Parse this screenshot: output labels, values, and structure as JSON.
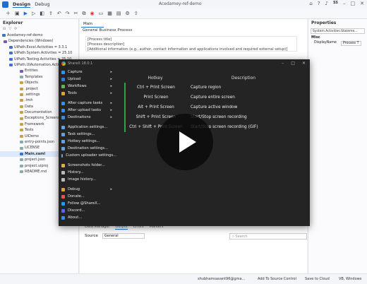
{
  "titlebar": {
    "tabs": [
      "Design",
      "Debug"
    ],
    "title": "Acedamey-ref-demo",
    "avatar_initials": "SS",
    "icons": [
      "home-icon",
      "question-icon",
      "bell-icon",
      "minimize-icon",
      "maximize-icon",
      "close-icon"
    ]
  },
  "explorer": {
    "title": "Explorer",
    "items": [
      "Acedamey-ref-demo",
      "Dependencies (Windows)",
      "UiPath.Excel.Activities = 3.3.1",
      "UiPath.System.Activities = 25.10",
      "UiPath.Testing.Activities = 25.10",
      "UiPath.UIAutomation.Activities",
      "Entities",
      "Templates",
      "Objects",
      ".project",
      ".settings",
      ".tmh",
      "Data",
      "Documentation",
      "Exceptions_Screenshots",
      "Framework",
      "Tests",
      "UiDemo",
      "entry-points.json",
      "LICENSE",
      "Main.xaml",
      "project.json",
      "project.uiproj",
      "README.md"
    ]
  },
  "editor": {
    "tab": "Main",
    "breadcrumb": "General Business Process",
    "comment_lines": [
      "[Process title]",
      "[Process description]",
      "[Additional information (e.g., author, contact information and applications involved and required external setup)]"
    ]
  },
  "output": {
    "tabs": [
      "Data Manager",
      "Output",
      "Errors",
      "Markers"
    ],
    "source_label": "Source",
    "source_value": "General",
    "search_placeholder": "Search"
  },
  "properties": {
    "title": "Properties",
    "search": "System.Activities.Stateme...",
    "group": "Misc",
    "row_label": "DisplayName",
    "row_value": "Process T"
  },
  "statusbar": {
    "user": "shubhamsavant96@gma...",
    "source_control": "Add To Source Control",
    "cloud": "Save to Cloud",
    "language": "VB, Windows"
  },
  "sharex": {
    "title": "ShareX 18.0.1",
    "menu": [
      {
        "label": "Capture",
        "submenu": true,
        "icon": "#3a8ee6"
      },
      {
        "label": "Upload",
        "submenu": true,
        "icon": "#2d7dd2"
      },
      {
        "label": "Workflows",
        "submenu": true,
        "icon": "#6ab04c"
      },
      {
        "label": "Tools",
        "submenu": true,
        "icon": "#e1a140"
      },
      {
        "sep": true
      },
      {
        "label": "After capture tasks",
        "submenu": true,
        "icon": "#3a8ee6"
      },
      {
        "label": "After upload tasks",
        "submenu": true,
        "icon": "#3a8ee6"
      },
      {
        "label": "Destinations",
        "submenu": true,
        "icon": "#3a8ee6"
      },
      {
        "sep": true
      },
      {
        "label": "Application settings...",
        "submenu": false,
        "icon": "#6aa0d8"
      },
      {
        "label": "Task settings...",
        "submenu": false,
        "icon": "#6aa0d8"
      },
      {
        "label": "Hotkey settings...",
        "submenu": false,
        "icon": "#6aa0d8"
      },
      {
        "label": "Destination settings...",
        "submenu": false,
        "icon": "#6aa0d8"
      },
      {
        "label": "Custom uploader settings...",
        "submenu": false,
        "icon": "#6aa0d8"
      },
      {
        "sep": true
      },
      {
        "label": "Screenshots folder...",
        "submenu": false,
        "icon": "#d9b24a"
      },
      {
        "label": "History...",
        "submenu": false,
        "icon": "#bbbbbb"
      },
      {
        "label": "Image history...",
        "submenu": false,
        "icon": "#bbbbbb"
      },
      {
        "sep": true
      },
      {
        "label": "Debug",
        "submenu": true,
        "icon": "#e0a03c"
      },
      {
        "label": "Donate...",
        "submenu": false,
        "icon": "#e05555"
      },
      {
        "label": "Follow @ShareX...",
        "submenu": false,
        "icon": "#1d9bf0"
      },
      {
        "label": "Discord...",
        "submenu": false,
        "icon": "#5865f2"
      },
      {
        "label": "About...",
        "submenu": false,
        "icon": "#3a8ee6"
      }
    ],
    "hotkeys": {
      "headers": [
        "Hotkey",
        "Description"
      ],
      "rows": [
        {
          "hotkey": "Ctrl + Print Screen",
          "description": "Capture region"
        },
        {
          "hotkey": "Print Screen",
          "description": "Capture entire screen"
        },
        {
          "hotkey": "Alt + Print Screen",
          "description": "Capture active window"
        },
        {
          "hotkey": "Shift + Print Screen",
          "description": "Start/Stop screen recording"
        },
        {
          "hotkey": "Ctrl + Shift + Print Screen",
          "description": "Start/Stop screen recording (GIF)"
        }
      ]
    }
  },
  "colors": {
    "accent": "#1a6fd6",
    "sharex_bg": "#242424",
    "hotkey_active": "#2ea44f"
  }
}
